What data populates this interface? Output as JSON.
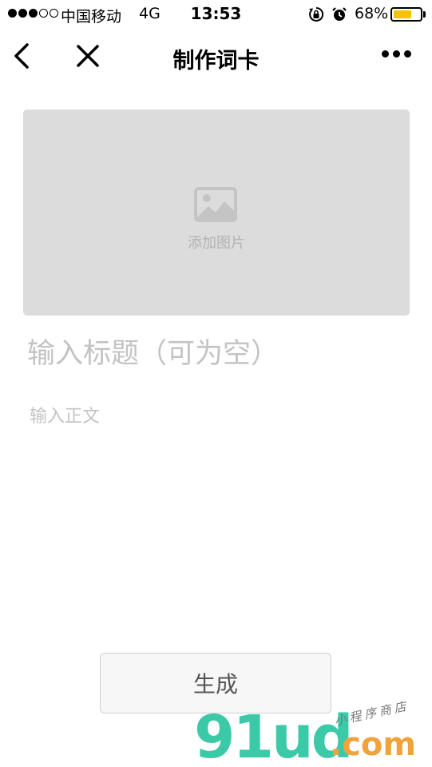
{
  "status_bar": {
    "carrier": "中国移动",
    "network": "4G",
    "time": "13:53",
    "battery_percent": "68%",
    "battery_level": 0.68,
    "battery_color": "#f5c400",
    "signal_strength": 3,
    "signal_max": 5,
    "icons": [
      "rotation-lock-icon",
      "alarm-icon"
    ]
  },
  "nav": {
    "title": "制作词卡",
    "back_icon": "chevron-left-icon",
    "close_icon": "close-icon",
    "more_icon": "more-dots-icon"
  },
  "image_upload": {
    "label": "添加图片",
    "icon": "image-icon"
  },
  "form": {
    "title_placeholder": "输入标题（可为空）",
    "title_value": "",
    "body_placeholder": "输入正文",
    "body_value": ""
  },
  "actions": {
    "generate_label": "生成"
  },
  "watermark": {
    "main": "91ud",
    "suffix": ".com",
    "sub": "小程序商店"
  }
}
